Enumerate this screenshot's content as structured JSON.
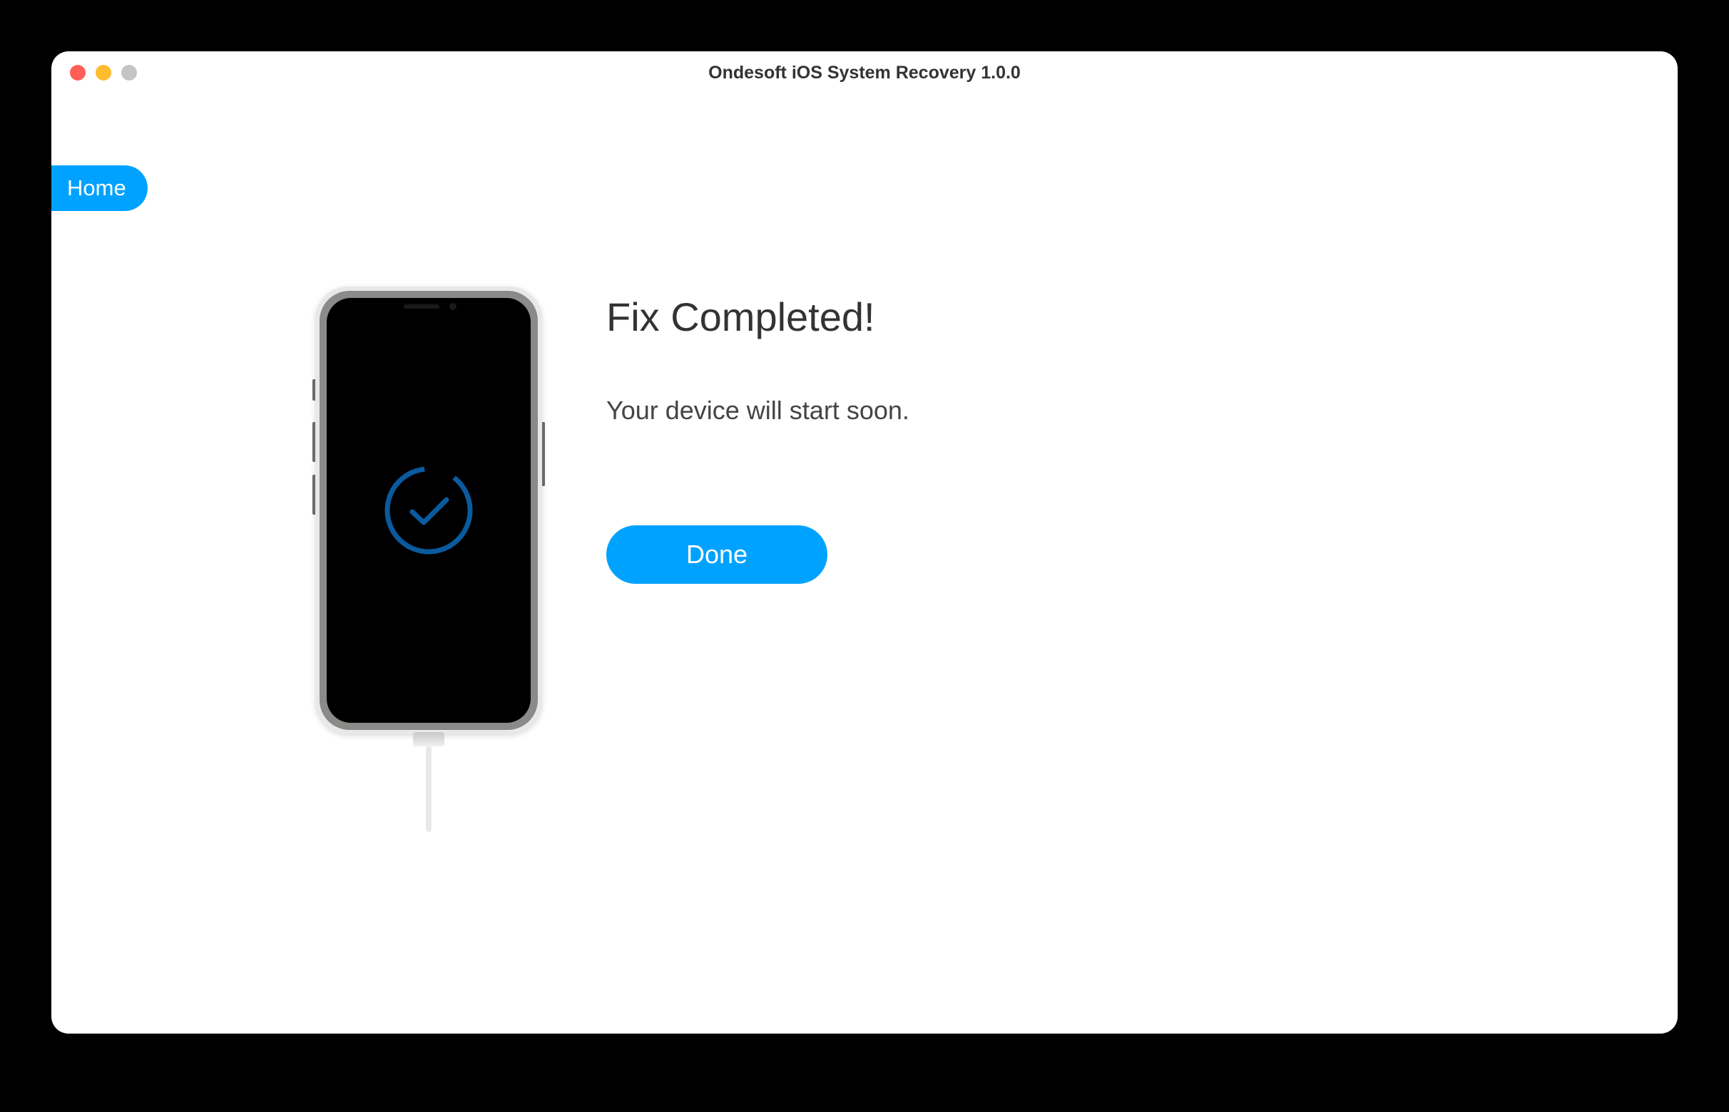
{
  "window": {
    "title": "Ondesoft iOS System Recovery 1.0.0"
  },
  "nav": {
    "home_label": "Home"
  },
  "main": {
    "heading": "Fix Completed!",
    "subtext": "Your device will start soon.",
    "done_label": "Done"
  },
  "colors": {
    "accent": "#00a2ff"
  }
}
